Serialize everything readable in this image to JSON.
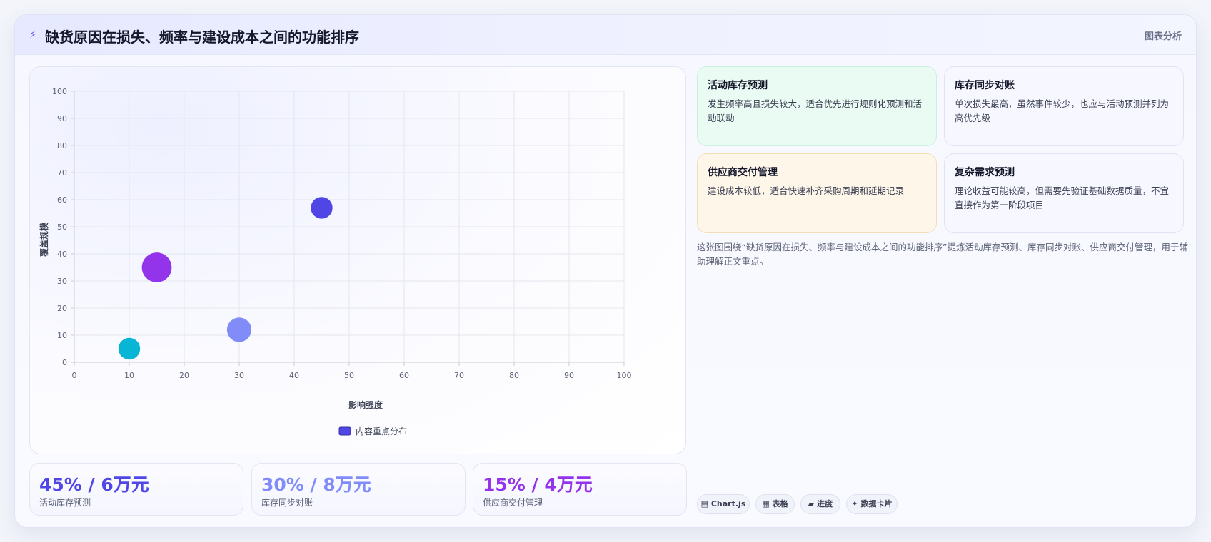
{
  "header": {
    "icon": "lightning-icon",
    "title": "缺货原因在损失、频率与建设成本之间的功能排序",
    "tag": "图表分析"
  },
  "chart_data": {
    "type": "bubble",
    "xlabel": "影响强度",
    "ylabel": "覆盖规模",
    "xlim": [
      0,
      100
    ],
    "ylim": [
      0,
      100
    ],
    "xticks": [
      0,
      10,
      20,
      30,
      40,
      50,
      60,
      70,
      80,
      90,
      100
    ],
    "yticks": [
      0,
      10,
      20,
      30,
      40,
      50,
      60,
      70,
      80,
      90,
      100
    ],
    "grid": true,
    "legend_position": "bottom",
    "series": [
      {
        "name": "内容重点分布",
        "color": "#4f46e5",
        "points": [
          {
            "x": 45,
            "y": 57,
            "r": 8,
            "color": "#4f46e5"
          },
          {
            "x": 15,
            "y": 35,
            "r": 11,
            "color": "#9333ea"
          },
          {
            "x": 30,
            "y": 12,
            "r": 9,
            "color": "#818cf8"
          },
          {
            "x": 10,
            "y": 5,
            "r": 8,
            "color": "#06b6d4"
          }
        ]
      }
    ]
  },
  "stats": [
    {
      "value": "45% / 6万元",
      "label": "活动库存预测",
      "color": "#4f46e5"
    },
    {
      "value": "30% / 8万元",
      "label": "库存同步对账",
      "color": "#818cf8"
    },
    {
      "value": "15% / 4万元",
      "label": "供应商交付管理",
      "color": "#9333ea"
    }
  ],
  "cards": [
    {
      "title": "活动库存预测",
      "text": "发生频率高且损失较大，适合优先进行规则化预测和活动联动"
    },
    {
      "title": "库存同步对账",
      "text": "单次损失最高，虽然事件较少，也应与活动预测并列为高优先级"
    },
    {
      "title": "供应商交付管理",
      "text": "建设成本较低，适合快速补齐采购周期和延期记录"
    },
    {
      "title": "复杂需求预测",
      "text": "理论收益可能较高，但需要先验证基础数据质量，不宜直接作为第一阶段项目"
    }
  ],
  "description": "这张图围绕“缺货原因在损失、频率与建设成本之间的功能排序”提炼活动库存预测、库存同步对账、供应商交付管理，用于辅助理解正文重点。",
  "chips": [
    {
      "icon": "chart-icon",
      "glyph": "▤",
      "label": "Chart.js"
    },
    {
      "icon": "table-icon",
      "glyph": "▦",
      "label": "表格"
    },
    {
      "icon": "progress-icon",
      "glyph": "▰",
      "label": "进度"
    },
    {
      "icon": "sparkle-icon",
      "glyph": "✦",
      "label": "数据卡片"
    }
  ]
}
